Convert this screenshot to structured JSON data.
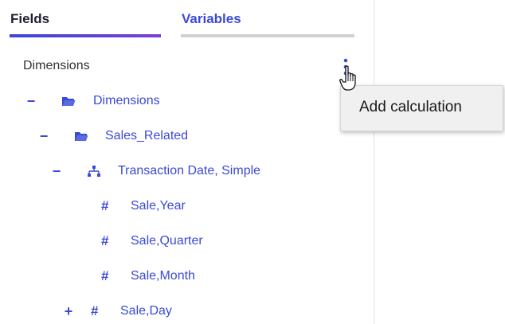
{
  "tabs": {
    "fields_label": "Fields",
    "variables_label": "Variables"
  },
  "section": {
    "heading": "Dimensions"
  },
  "tree": {
    "dimensions_folder": {
      "toggle": "−",
      "label": "Dimensions",
      "icon": "folder-open-icon"
    },
    "sales_related_folder": {
      "toggle": "−",
      "label": "Sales_Related",
      "icon": "folder-open-icon"
    },
    "hierarchy": {
      "toggle": "−",
      "label": "Transaction Date, Simple",
      "icon": "hierarchy-icon"
    },
    "sale_year": {
      "label": "Sale,Year",
      "icon": "#"
    },
    "sale_quarter": {
      "label": "Sale,Quarter",
      "icon": "#"
    },
    "sale_month": {
      "label": "Sale,Month",
      "icon": "#"
    },
    "sale_day": {
      "toggle": "+",
      "label": "Sale,Day",
      "icon": "#"
    }
  },
  "context_menu": {
    "add_calculation_label": "Add calculation"
  },
  "colors": {
    "accent": "#3a4ad6",
    "tab_gradient_start": "#3a47d5",
    "tab_gradient_end": "#7b3fd4",
    "inactive_underline": "#d0d0d0",
    "menu_bg": "#f0f0f0"
  }
}
